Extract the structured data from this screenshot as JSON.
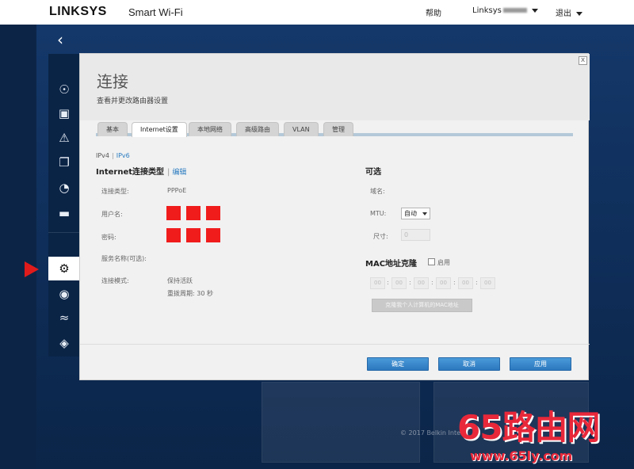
{
  "header": {
    "brand": "LINKSYS",
    "product": "Smart Wi-Fi",
    "help": "帮助",
    "account": "Linksys",
    "logout": "退出"
  },
  "sidebar": {
    "items": [
      {
        "icon": "router-icon"
      },
      {
        "icon": "toolbox-icon"
      },
      {
        "icon": "warning-icon"
      },
      {
        "icon": "devices-icon"
      },
      {
        "icon": "speed-icon"
      },
      {
        "icon": "storage-icon"
      },
      {
        "icon": "blank"
      },
      {
        "icon": "gears-icon",
        "active": true
      },
      {
        "icon": "camera-icon"
      },
      {
        "icon": "wifi-icon"
      },
      {
        "icon": "shield-icon"
      }
    ]
  },
  "modal": {
    "title": "连接",
    "subtitle": "查看并更改路由器设置",
    "close": "x",
    "tabs": [
      {
        "label": "基本",
        "active": false
      },
      {
        "label": "Internet设置",
        "active": true
      },
      {
        "label": "本地网络",
        "active": false
      },
      {
        "label": "高级路由",
        "active": false
      },
      {
        "label": "VLAN",
        "active": false
      },
      {
        "label": "管理",
        "active": false
      }
    ],
    "ipv4": "IPv4",
    "ipv6": "IPv6",
    "internet_section": {
      "title": "Internet连接类型",
      "edit": "编辑",
      "fields": {
        "conn_type_label": "连接类型:",
        "conn_type_value": "PPPoE",
        "username_label": "用户名:",
        "username_value": "",
        "password_label": "密码:",
        "service_name_label": "服务名称(可选):",
        "conn_mode_label": "连接模式:",
        "conn_mode_value": "保持活跃",
        "redial_value": "重拨周期: 30 秒"
      }
    },
    "optional_section": {
      "title": "可选",
      "domain_label": "域名:",
      "mtu_label": "MTU:",
      "mtu_value": "自动",
      "size_label": "尺寸:",
      "size_value": "0"
    },
    "mac_section": {
      "title": "MAC地址克隆",
      "enable": "启用",
      "octets": [
        "00",
        "00",
        "00",
        "00",
        "00",
        "00"
      ],
      "clone_button": "克隆我个人计算机的MAC地址"
    },
    "buttons": {
      "ok": "确定",
      "cancel": "取消",
      "apply": "应用"
    }
  },
  "footer": {
    "copyright": "© 2017 Belkin Inte"
  },
  "watermark": {
    "site_name": "65路由网",
    "site_url": "www.65ly.com"
  },
  "colors": {
    "accent": "#2c78bf",
    "redaction": "#f01c1c",
    "background": "#0e2c56"
  }
}
